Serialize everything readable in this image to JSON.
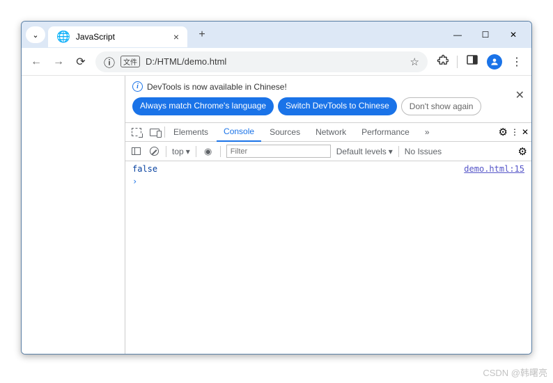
{
  "tab": {
    "title": "JavaScript",
    "close": "×",
    "new": "+"
  },
  "win": {
    "min": "—",
    "max": "☐",
    "close": "✕"
  },
  "nav": {
    "back": "←",
    "fwd": "→",
    "reload": "⟳"
  },
  "addr": {
    "info": "ⓘ",
    "type": "文件",
    "url": "D:/HTML/demo.html",
    "star": "☆"
  },
  "ext": {
    "puzzle": "⧉",
    "panel": "◨",
    "menu": "⋮"
  },
  "info": {
    "text": "DevTools is now available in Chinese!",
    "btn1": "Always match Chrome's language",
    "btn2": "Switch DevTools to Chinese",
    "btn3": "Don't show again",
    "close": "✕"
  },
  "tabs": {
    "elements": "Elements",
    "console": "Console",
    "sources": "Sources",
    "network": "Network",
    "perf": "Performance",
    "more": "»",
    "gear": "⚙",
    "dots": "⋮",
    "x": "✕"
  },
  "fb": {
    "top": "top",
    "tri": "▾",
    "filter_ph": "Filter",
    "levels": "Default levels",
    "issues": "No Issues",
    "gear": "⚙"
  },
  "con": {
    "value": "false",
    "source": "demo.html:15",
    "prompt": "›"
  },
  "watermark": "CSDN @韩曙亮"
}
